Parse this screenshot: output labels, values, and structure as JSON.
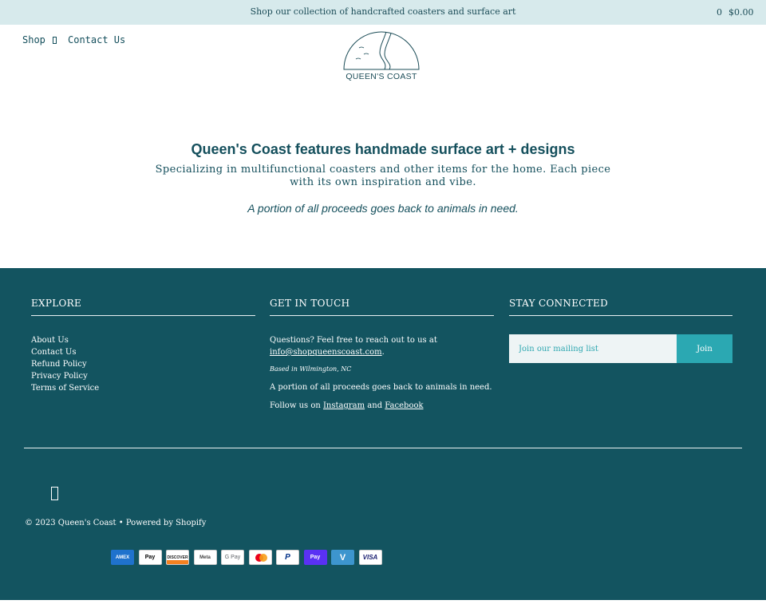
{
  "colors": {
    "announcement_bg": "#d7eaec",
    "brand_teal": "#144f5c",
    "footer_bg": "#135460",
    "join_button": "#2ba8b2"
  },
  "announcement": {
    "text": "Shop our collection of handcrafted coasters and surface art",
    "cart_count": "0",
    "cart_total": "$0.00"
  },
  "nav": {
    "shop_label": "Shop",
    "shop_icon": "chevron-down-icon",
    "contact_label": "Contact Us"
  },
  "logo": {
    "text": "QUEEN'S COAST"
  },
  "hero": {
    "title": "Queen's Coast features handmade surface art + designs",
    "subtitle": "Specializing in multifunctional coasters and other items for the home. Each piece with its own inspiration and vibe.",
    "note": "A portion of all proceeds goes back to animals in need."
  },
  "footer": {
    "explore": {
      "heading": "EXPLORE",
      "links": [
        "About Us",
        "Contact Us",
        "Refund Policy",
        "Privacy Policy",
        "Terms of Service"
      ]
    },
    "touch": {
      "heading": "GET IN TOUCH",
      "questions": "Questions? Feel free to reach out to us at",
      "email": "info@shopqueenscoast.com",
      "email_suffix": ".",
      "location": "Based in Wilmington, NC",
      "animals": "A portion of all proceeds goes back to animals in need.",
      "follow_prefix": "Follow us on",
      "instagram": "Instagram",
      "and": "and",
      "facebook": "Facebook"
    },
    "connected": {
      "heading": "STAY CONNECTED",
      "placeholder": "Join our mailing list",
      "button": "Join"
    },
    "social_icon": "facebook-icon",
    "copyright": "© 2023 Queen's Coast • Powered by Shopify",
    "payments": [
      {
        "name": "amex-icon",
        "label": "AMEX"
      },
      {
        "name": "apple-pay-icon",
        "label": "Pay"
      },
      {
        "name": "discover-icon",
        "label": "DISCOVER"
      },
      {
        "name": "meta-pay-icon",
        "label": "Meta"
      },
      {
        "name": "google-pay-icon",
        "label": "G Pay"
      },
      {
        "name": "mastercard-icon",
        "label": ""
      },
      {
        "name": "paypal-icon",
        "label": "P"
      },
      {
        "name": "shop-pay-icon",
        "label": "Pay"
      },
      {
        "name": "venmo-icon",
        "label": "V"
      },
      {
        "name": "visa-icon",
        "label": "VISA"
      }
    ]
  }
}
